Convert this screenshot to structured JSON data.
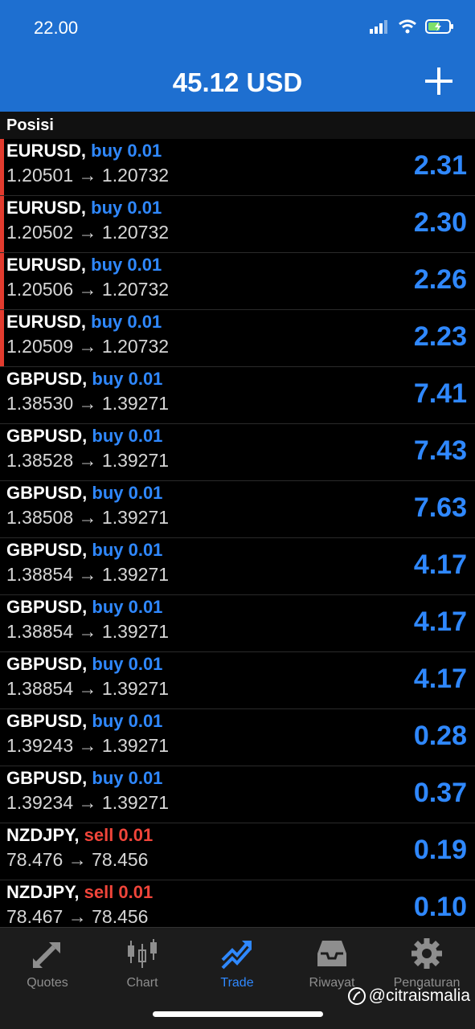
{
  "status_bar": {
    "time": "22.00"
  },
  "header": {
    "balance": "45.12 USD"
  },
  "section_title": "Posisi",
  "positions": [
    {
      "symbol": "EURUSD,",
      "direction": "buy 0.01",
      "dir": "buy",
      "prices": "1.20501 → 1.20732",
      "profit": "2.31",
      "marked": true
    },
    {
      "symbol": "EURUSD,",
      "direction": "buy 0.01",
      "dir": "buy",
      "prices": "1.20502 → 1.20732",
      "profit": "2.30",
      "marked": true
    },
    {
      "symbol": "EURUSD,",
      "direction": "buy 0.01",
      "dir": "buy",
      "prices": "1.20506 → 1.20732",
      "profit": "2.26",
      "marked": true
    },
    {
      "symbol": "EURUSD,",
      "direction": "buy 0.01",
      "dir": "buy",
      "prices": "1.20509 → 1.20732",
      "profit": "2.23",
      "marked": true
    },
    {
      "symbol": "GBPUSD,",
      "direction": "buy 0.01",
      "dir": "buy",
      "prices": "1.38530 → 1.39271",
      "profit": "7.41",
      "marked": false
    },
    {
      "symbol": "GBPUSD,",
      "direction": "buy 0.01",
      "dir": "buy",
      "prices": "1.38528 → 1.39271",
      "profit": "7.43",
      "marked": false
    },
    {
      "symbol": "GBPUSD,",
      "direction": "buy 0.01",
      "dir": "buy",
      "prices": "1.38508 → 1.39271",
      "profit": "7.63",
      "marked": false
    },
    {
      "symbol": "GBPUSD,",
      "direction": "buy 0.01",
      "dir": "buy",
      "prices": "1.38854 → 1.39271",
      "profit": "4.17",
      "marked": false
    },
    {
      "symbol": "GBPUSD,",
      "direction": "buy 0.01",
      "dir": "buy",
      "prices": "1.38854 → 1.39271",
      "profit": "4.17",
      "marked": false
    },
    {
      "symbol": "GBPUSD,",
      "direction": "buy 0.01",
      "dir": "buy",
      "prices": "1.38854 → 1.39271",
      "profit": "4.17",
      "marked": false
    },
    {
      "symbol": "GBPUSD,",
      "direction": "buy 0.01",
      "dir": "buy",
      "prices": "1.39243 → 1.39271",
      "profit": "0.28",
      "marked": false
    },
    {
      "symbol": "GBPUSD,",
      "direction": "buy 0.01",
      "dir": "buy",
      "prices": "1.39234 → 1.39271",
      "profit": "0.37",
      "marked": false
    },
    {
      "symbol": "NZDJPY,",
      "direction": "sell 0.01",
      "dir": "sell",
      "prices": "78.476 → 78.456",
      "profit": "0.19",
      "marked": false
    },
    {
      "symbol": "NZDJPY,",
      "direction": "sell 0.01",
      "dir": "sell",
      "prices": "78.467 → 78.456",
      "profit": "0.10",
      "marked": false
    }
  ],
  "tabs": [
    {
      "label": "Quotes",
      "icon": "quotes-icon",
      "active": false
    },
    {
      "label": "Chart",
      "icon": "chart-icon",
      "active": false
    },
    {
      "label": "Trade",
      "icon": "trade-icon",
      "active": true
    },
    {
      "label": "Riwayat",
      "icon": "history-icon",
      "active": false
    },
    {
      "label": "Pengaturan",
      "icon": "settings-icon",
      "active": false
    }
  ],
  "watermark": "@citraismalia",
  "colors": {
    "header": "#1e6fd0",
    "buy": "#2f88ff",
    "sell": "#f0453a",
    "profit": "#2f88ff",
    "marker": "#e23b2e"
  }
}
